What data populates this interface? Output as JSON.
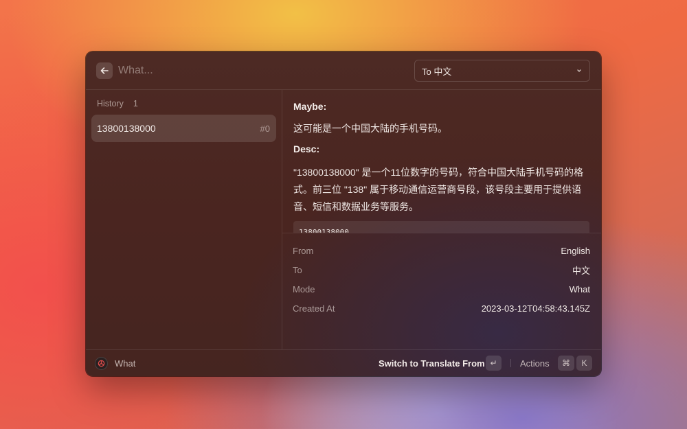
{
  "header": {
    "search_placeholder": "What...",
    "search_value": "",
    "language_select": "To 中文"
  },
  "sidebar": {
    "section_title": "History",
    "section_count": "1",
    "items": [
      {
        "label": "13800138000",
        "index": "#0"
      }
    ]
  },
  "detail": {
    "maybe_heading": "Maybe:",
    "maybe_text": "这可能是一个中国大陆的手机号码。",
    "desc_heading": "Desc:",
    "desc_text": "\"13800138000\" 是一个11位数字的号码，符合中国大陆手机号码的格式。前三位 \"138\" 属于移动通信运营商号段，该号段主要用于提供语音、短信和数据业务等服务。",
    "code": "13800138000"
  },
  "metadata": [
    {
      "key": "From",
      "value": "English"
    },
    {
      "key": "To",
      "value": "中文"
    },
    {
      "key": "Mode",
      "value": "What"
    },
    {
      "key": "Created At",
      "value": "2023-03-12T04:58:43.145Z"
    }
  ],
  "footer": {
    "extension_name": "What",
    "primary_action": "Switch to Translate From",
    "primary_shortcut": "↵",
    "actions_label": "Actions",
    "actions_shortcut_mod": "⌘",
    "actions_shortcut_key": "K"
  },
  "icons": {
    "back": "arrow-left-icon",
    "chevron": "chevron-down-icon",
    "extension": "openai-icon"
  }
}
